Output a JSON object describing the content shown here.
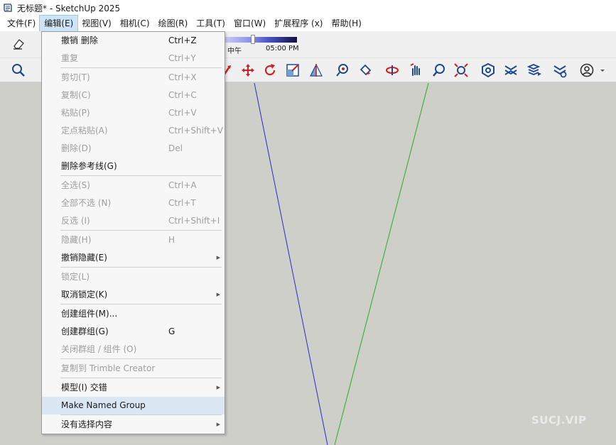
{
  "window": {
    "title": "无标题* - SketchUp 2025"
  },
  "menubar": {
    "items": [
      "文件(F)",
      "编辑(E)",
      "视图(V)",
      "相机(C)",
      "绘图(R)",
      "工具(T)",
      "窗口(W)",
      "扩展程序 (x)",
      "帮助(H)"
    ]
  },
  "shadow": {
    "label_noon": "中午",
    "label_time": "05:00 PM"
  },
  "edit_menu": {
    "items": [
      {
        "label": "撤销 删除",
        "shortcut": "Ctrl+Z",
        "enabled": true
      },
      {
        "label": "重复",
        "shortcut": "Ctrl+Y",
        "enabled": false
      },
      {
        "separator": true
      },
      {
        "label": "剪切(T)",
        "shortcut": "Ctrl+X",
        "enabled": false
      },
      {
        "label": "复制(C)",
        "shortcut": "Ctrl+C",
        "enabled": false
      },
      {
        "label": "粘贴(P)",
        "shortcut": "Ctrl+V",
        "enabled": false
      },
      {
        "label": "定点粘贴(A)",
        "shortcut": "Ctrl+Shift+V",
        "enabled": false
      },
      {
        "label": "删除(D)",
        "shortcut": "Del",
        "enabled": false
      },
      {
        "label": "删除参考线(G)",
        "shortcut": "",
        "enabled": true
      },
      {
        "separator": true
      },
      {
        "label": "全选(S)",
        "shortcut": "Ctrl+A",
        "enabled": false
      },
      {
        "label": "全部不选 (N)",
        "shortcut": "Ctrl+T",
        "enabled": false
      },
      {
        "label": "反选 (I)",
        "shortcut": "Ctrl+Shift+I",
        "enabled": false
      },
      {
        "separator": true
      },
      {
        "label": "隐藏(H)",
        "shortcut": "H",
        "enabled": false
      },
      {
        "label": "撤销隐藏(E)",
        "shortcut": "",
        "enabled": true,
        "submenu": true
      },
      {
        "separator": true
      },
      {
        "label": "锁定(L)",
        "shortcut": "",
        "enabled": false
      },
      {
        "label": "取消锁定(K)",
        "shortcut": "",
        "enabled": true,
        "submenu": true
      },
      {
        "separator": true
      },
      {
        "label": "创建组件(M)...",
        "shortcut": "",
        "enabled": true
      },
      {
        "label": "创建群组(G)",
        "shortcut": "G",
        "enabled": true
      },
      {
        "label": "关闭群组 / 组件 (O)",
        "shortcut": "",
        "enabled": false
      },
      {
        "separator": true
      },
      {
        "label": "复制到 Trimble Creator",
        "shortcut": "",
        "enabled": false
      },
      {
        "separator": true
      },
      {
        "label": "模型(I) 交错",
        "shortcut": "",
        "enabled": true,
        "submenu": true
      },
      {
        "label": "Make Named Group",
        "shortcut": "",
        "enabled": true,
        "highlighted": true
      },
      {
        "separator": true
      },
      {
        "label": "没有选择内容",
        "shortcut": "",
        "enabled": true,
        "submenu": true
      }
    ]
  },
  "watermark": "SUCJ.VIP",
  "axes": {
    "blue": "#2a2ad0",
    "green": "#22b022",
    "red": "#d02a2a"
  }
}
